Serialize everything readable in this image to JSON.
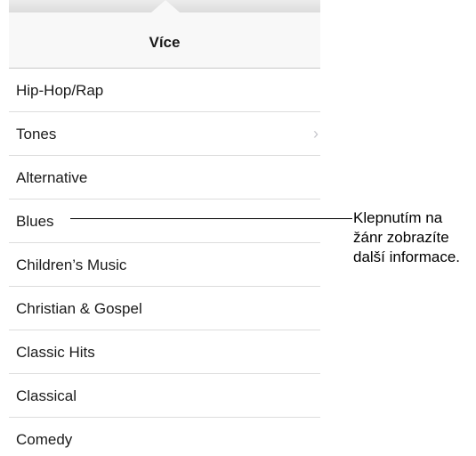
{
  "header": {
    "title": "Více"
  },
  "list": {
    "items": [
      {
        "label": "Hip-Hop/Rap",
        "has_chevron": false
      },
      {
        "label": "Tones",
        "has_chevron": true
      },
      {
        "label": "Alternative",
        "has_chevron": false
      },
      {
        "label": "Blues",
        "has_chevron": false
      },
      {
        "label": "Children’s Music",
        "has_chevron": false
      },
      {
        "label": "Christian & Gospel",
        "has_chevron": false
      },
      {
        "label": "Classic Hits",
        "has_chevron": false
      },
      {
        "label": "Classical",
        "has_chevron": false
      },
      {
        "label": "Comedy",
        "has_chevron": false
      }
    ],
    "chevron_icon": "chevron-right-icon",
    "chevron_glyph": "›"
  },
  "callout": {
    "lines": [
      "Klepnutím na",
      "žánr zobrazíte",
      "další informace."
    ]
  }
}
